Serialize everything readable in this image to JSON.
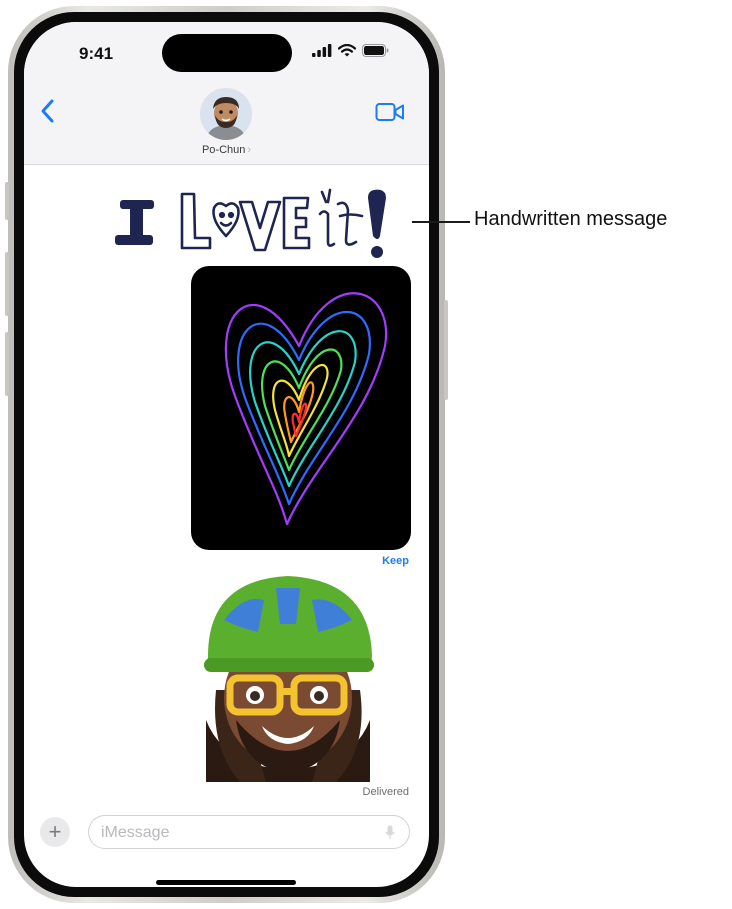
{
  "status_bar": {
    "time": "9:41"
  },
  "header": {
    "contact_name": "Po-Chun",
    "name_chevron": "›",
    "back_icon": "chevron-left-icon",
    "video_icon": "video-camera-icon"
  },
  "messages": {
    "handwritten_text": "I LOVE it!",
    "keep_label": "Keep",
    "delivered_label": "Delivered"
  },
  "input": {
    "add_label": "+",
    "placeholder": "iMessage"
  },
  "callouts": {
    "handwritten": "Handwritten message"
  },
  "colors": {
    "accent": "#1E7CF2",
    "ink": "#1E2550",
    "helmet": "#5BAF2E",
    "glasses": "#F4C430"
  }
}
